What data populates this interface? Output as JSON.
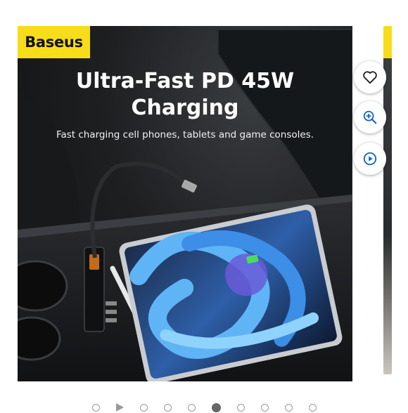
{
  "slide": {
    "brand": "Baseus",
    "headline_line1": "Ultra-Fast PD 45W",
    "headline_line2": "Charging",
    "subline": "Fast charging cell phones, tablets and game consoles."
  },
  "actions": {
    "favorite": "heart-icon",
    "zoom": "zoom-in-icon",
    "video": "play-icon"
  },
  "carousel": {
    "dot_count": 10,
    "active_index": 5
  },
  "colors": {
    "brand_yellow": "#f7dd19",
    "accent_blue": "#1565c0"
  }
}
